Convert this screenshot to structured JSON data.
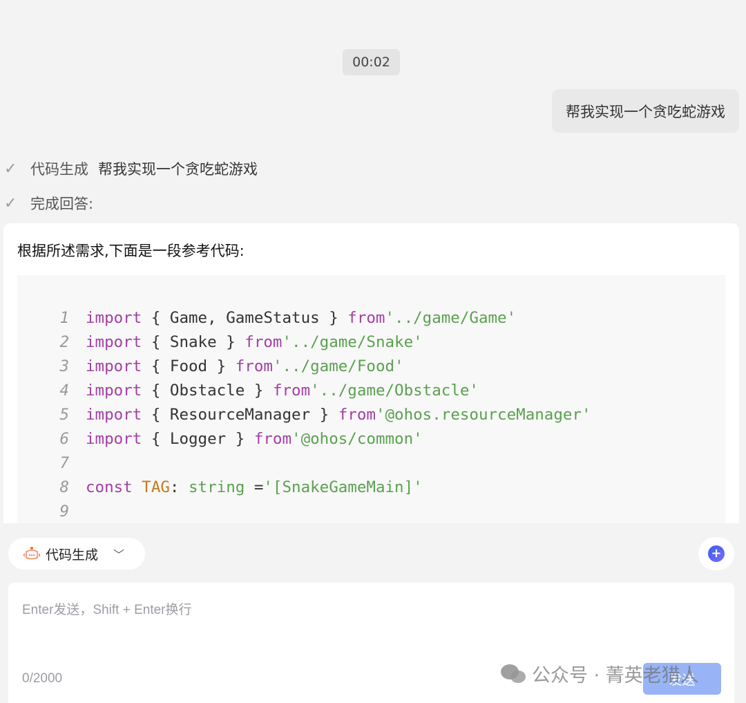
{
  "chat": {
    "timestamp": "00:02",
    "user_message": "帮我实现一个贪吃蛇游戏",
    "steps": [
      {
        "label": "代码生成",
        "query": "帮我实现一个贪吃蛇游戏"
      },
      {
        "label": "完成回答:"
      }
    ],
    "answer_intro": "根据所述需求,下面是一段参考代码:",
    "code_lines": [
      [
        [
          "kw",
          "import"
        ],
        [
          "txt",
          " { Game, GameStatus } "
        ],
        [
          "kw",
          "from"
        ],
        [
          "str",
          "'../game/Game'"
        ]
      ],
      [
        [
          "kw",
          "import"
        ],
        [
          "txt",
          " { Snake } "
        ],
        [
          "kw",
          "from"
        ],
        [
          "str",
          "'../game/Snake'"
        ]
      ],
      [
        [
          "kw",
          "import"
        ],
        [
          "txt",
          " { Food } "
        ],
        [
          "kw",
          "from"
        ],
        [
          "str",
          "'../game/Food'"
        ]
      ],
      [
        [
          "kw",
          "import"
        ],
        [
          "txt",
          " { Obstacle } "
        ],
        [
          "kw",
          "from"
        ],
        [
          "str",
          "'../game/Obstacle'"
        ]
      ],
      [
        [
          "kw",
          "import"
        ],
        [
          "txt",
          " { ResourceManager } "
        ],
        [
          "kw",
          "from"
        ],
        [
          "str",
          "'@ohos.resourceManager'"
        ]
      ],
      [
        [
          "kw",
          "import"
        ],
        [
          "txt",
          " { Logger } "
        ],
        [
          "kw",
          "from"
        ],
        [
          "str",
          "'@ohos/common'"
        ]
      ],
      [],
      [
        [
          "kw",
          "const"
        ],
        [
          "txt",
          " "
        ],
        [
          "cst",
          "TAG"
        ],
        [
          "txt",
          ": "
        ],
        [
          "typ",
          "string"
        ],
        [
          "txt",
          " ="
        ],
        [
          "str",
          "'[SnakeGameMain]'"
        ]
      ],
      []
    ]
  },
  "composer": {
    "mode_label": "代码生成",
    "mode_icon": "code-robot-icon",
    "new_chat_icon": "new-chat-icon",
    "placeholder": "Enter发送，Shift + Enter换行",
    "char_count": "0/2000",
    "send_label": "发送"
  },
  "watermark": "公众号 · 菁英老猎人",
  "colors": {
    "keyword": "#a33ea6",
    "string": "#5aa04f",
    "constant": "#c27a1a",
    "send": "#98b4f6"
  }
}
